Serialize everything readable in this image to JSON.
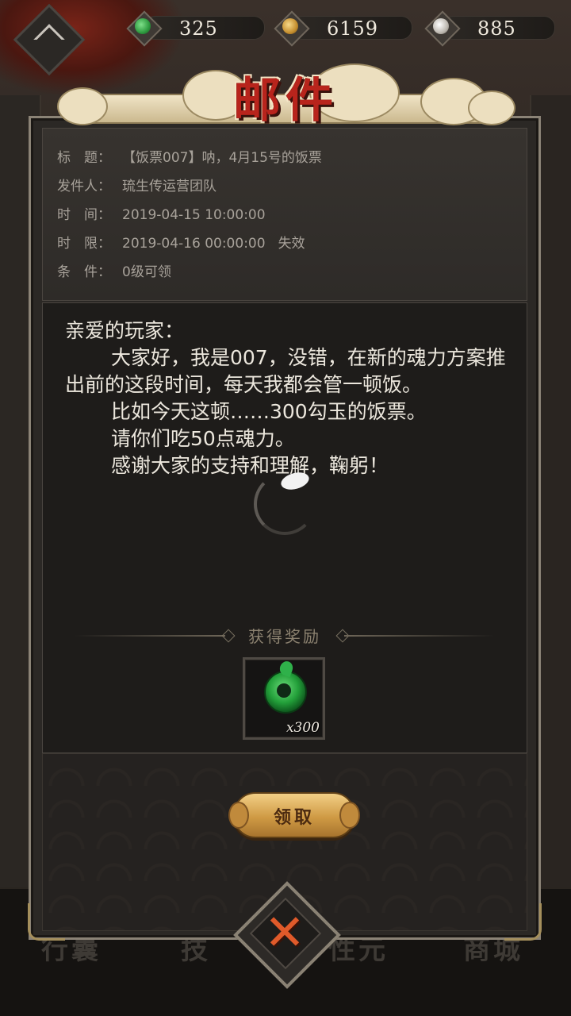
{
  "currencies": {
    "magatama": {
      "value": "325",
      "icon": "magatama-icon",
      "color": "#3fae4d"
    },
    "gold": {
      "value": "6159",
      "icon": "gold-coin-icon",
      "color": "#d6a13a"
    },
    "amulet": {
      "value": "885",
      "icon": "amulet-icon",
      "color": "#cfcac2"
    }
  },
  "title": "邮件",
  "mail": {
    "subject_label": "标　题：",
    "subject": "【饭票007】呐，4月15号的饭票",
    "sender_label": "发件人：",
    "sender": "琉生传运营团队",
    "time_label": "时　间：",
    "time": "2019-04-15 10:00:00",
    "limit_label": "时　限：",
    "limit": "2019-04-16 00:00:00",
    "limit_status": "失效",
    "condition_label": "条　件：",
    "condition": "0级可领"
  },
  "letter": {
    "greeting": "亲爱的玩家：",
    "p1": "大家好，我是007，没错，在新的魂力方案推出前的这段时间，每天我都会管一顿饭。",
    "p2": "比如今天这顿……300勾玉的饭票。",
    "p3": "请你们吃50点魂力。",
    "p4": "感谢大家的支持和理解，鞠躬！"
  },
  "reward": {
    "title": "获得奖励",
    "item_icon": "magatama-icon",
    "quantity": "x300"
  },
  "buttons": {
    "claim": "领取",
    "close_icon": "close-icon"
  },
  "background_tabs": [
    "行囊",
    "技",
    "性元",
    "商城"
  ]
}
